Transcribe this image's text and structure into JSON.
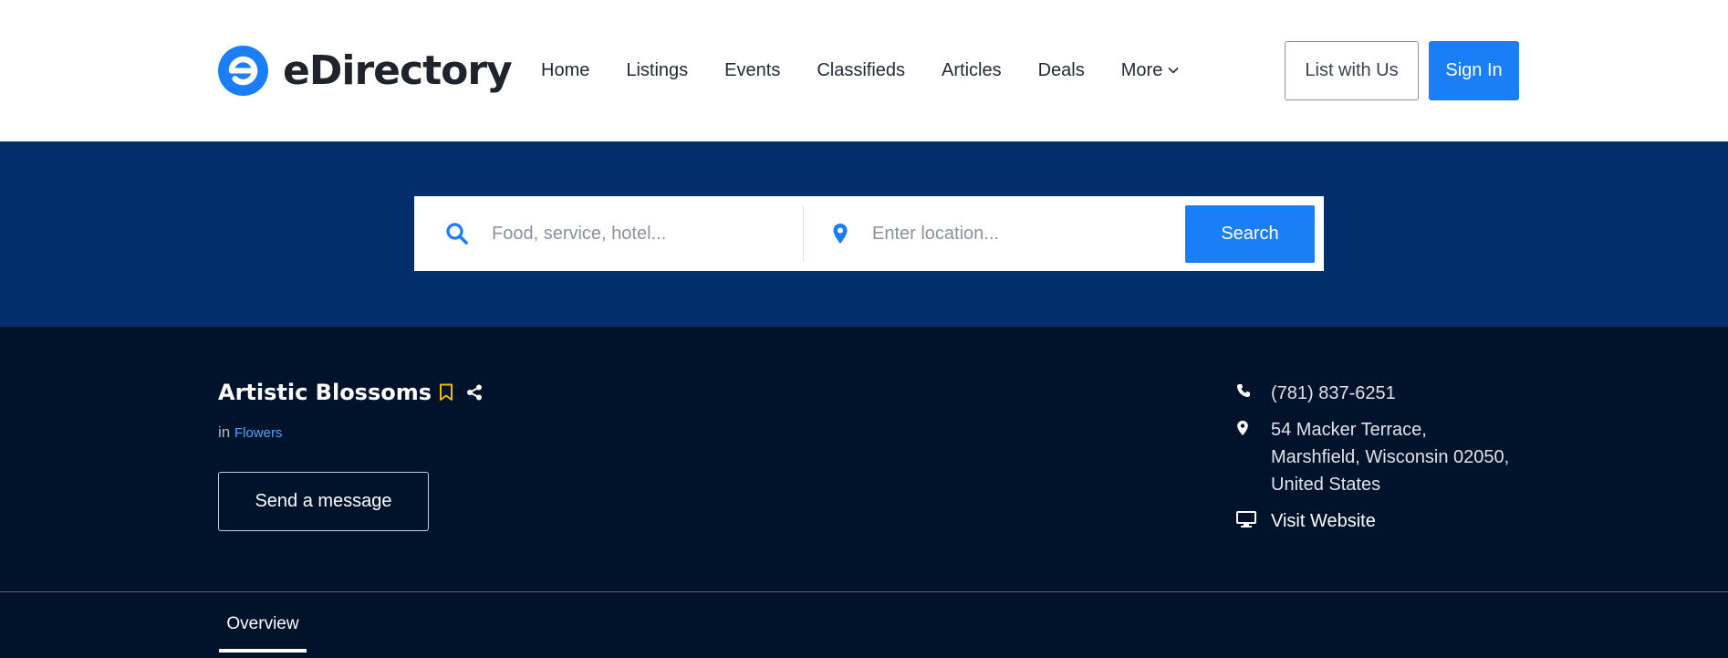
{
  "brand": {
    "name": "eDirectory",
    "logo_letter": "e",
    "accent_color": "#1a7ef7",
    "hero_color": "#022e6b",
    "detail_bg_color": "#01122b"
  },
  "nav": {
    "items": [
      {
        "label": "Home"
      },
      {
        "label": "Listings"
      },
      {
        "label": "Events"
      },
      {
        "label": "Classifieds"
      },
      {
        "label": "Articles"
      },
      {
        "label": "Deals"
      }
    ],
    "more_label": "More",
    "more_icon": "chevron-down-icon"
  },
  "header_actions": {
    "list_with_us": "List with Us",
    "sign_in": "Sign In"
  },
  "search": {
    "keyword_placeholder": "Food, service, hotel...",
    "keyword_value": "",
    "keyword_icon": "search-icon",
    "location_placeholder": "Enter location...",
    "location_value": "",
    "location_icon": "map-pin-icon",
    "button_label": "Search"
  },
  "listing": {
    "title": "Artistic Blossoms",
    "bookmark_icon": "bookmark-icon",
    "bookmark_color": "#f5b800",
    "share_icon": "share-icon",
    "category_prefix": "in",
    "category": "Flowers",
    "message_button": "Send a message"
  },
  "contact": {
    "phone_icon": "phone-icon",
    "phone": "(781) 837-6251",
    "address_icon": "map-pin-icon",
    "address_line1": "54 Macker Terrace,",
    "address_line2": "Marshfield, Wisconsin 02050,",
    "address_line3": "United States",
    "website_icon": "monitor-icon",
    "website_label": "Visit Website"
  },
  "tabs": [
    {
      "label": "Overview",
      "active": true
    }
  ]
}
